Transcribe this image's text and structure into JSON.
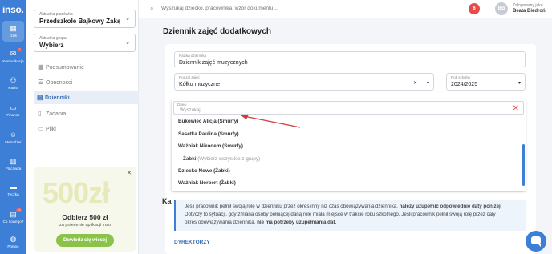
{
  "app": {
    "logo": "inso."
  },
  "rail": {
    "items": [
      {
        "label": "Dziś",
        "icon": "calendar-icon"
      },
      {
        "label": "Komunikacja",
        "icon": "chat-icon",
        "badge": "2"
      },
      {
        "label": "Kadra",
        "icon": "people-icon"
      },
      {
        "label": "Finanse",
        "icon": "wallet-icon"
      },
      {
        "label": "Menadżer",
        "icon": "user-cog-icon"
      },
      {
        "label": "Placówka",
        "icon": "building-icon"
      },
      {
        "label": "Teczka",
        "icon": "folder-icon"
      },
      {
        "label": "Co nowego?",
        "icon": "news-icon",
        "badge": "10"
      },
      {
        "label": "Pomoc",
        "icon": "globe-icon"
      }
    ]
  },
  "panel": {
    "placowka": {
      "label": "Aktualna placówka",
      "value": "Przedszkole Bajkowy Zakąt..."
    },
    "grupa": {
      "label": "Aktualna grupa",
      "value": "Wybierz"
    },
    "nav": [
      {
        "label": "Podsumowanie",
        "icon": "grid-icon"
      },
      {
        "label": "Obecności",
        "icon": "list-icon"
      },
      {
        "label": "Dzienniki",
        "icon": "book-icon"
      },
      {
        "label": "Zadania",
        "icon": "document-icon"
      },
      {
        "label": "Pliki",
        "icon": "folder-icon"
      }
    ]
  },
  "promo": {
    "big": "500zł",
    "title": "Odbierz 500 zł",
    "sub": "za polecenie aplikacji Inso",
    "button": "Dowiedz się więcej"
  },
  "topbar": {
    "search_placeholder": "Wyszukaj dziecko, pracownika, wzór dokumentu...",
    "notif": "6",
    "avatar": "BB",
    "logged_label": "Zalogowany jako",
    "user": "Beata Biedroń"
  },
  "page": {
    "title": "Dziennik zajęć dodatkowych"
  },
  "form": {
    "name": {
      "label": "Nazwa dziennika",
      "value": "Dziennik zajęć muzycznych"
    },
    "type": {
      "label": "Rodzaj zajęć",
      "value": "Kółko muzyczne"
    },
    "year": {
      "label": "Rok szkolny",
      "value": "2024/2025"
    },
    "child": {
      "label": "Dzieci",
      "placeholder": "Wyszukaj..."
    }
  },
  "dropdown": {
    "options": [
      {
        "text": "Bukowiec Alicja (Smurfy)"
      },
      {
        "text": "Sasetka Paulina (Smurfy)"
      },
      {
        "text": "Ważniak Nikodem (Smurfy)"
      },
      {
        "text": "Żabki",
        "hint": "(Wybierz wszystkie z grupy)"
      },
      {
        "text": "Dziecko Nowe (Żabki)"
      },
      {
        "text": "Ważniak Norbert (Żabki)"
      }
    ]
  },
  "section": {
    "title": "Ka"
  },
  "info": {
    "l1a": "Jeśli pracownik pełnił swoją rolę w dzienniku przez okres inny niż czas obowiązywania dziennika, ",
    "l1b": "należy uzupełnić odpowiednie daty poniżej.",
    "l2": "Dotyczy to sytuacji, gdy zmiana osoby pełniącej daną rolę miała miejsce w trakcie roku szkolnego. Jeśli pracownik pełnił swoją rolę przez cały",
    "l3a": "okres obowiązywania dziennika, ",
    "l3b": "nie ma potrzeby uzupełniania dat."
  },
  "dyrektorzy": "DYREKTORZY",
  "colors": {
    "accent": "#3d7fd6",
    "promo_green": "#8bc34a",
    "danger": "#e04646"
  }
}
